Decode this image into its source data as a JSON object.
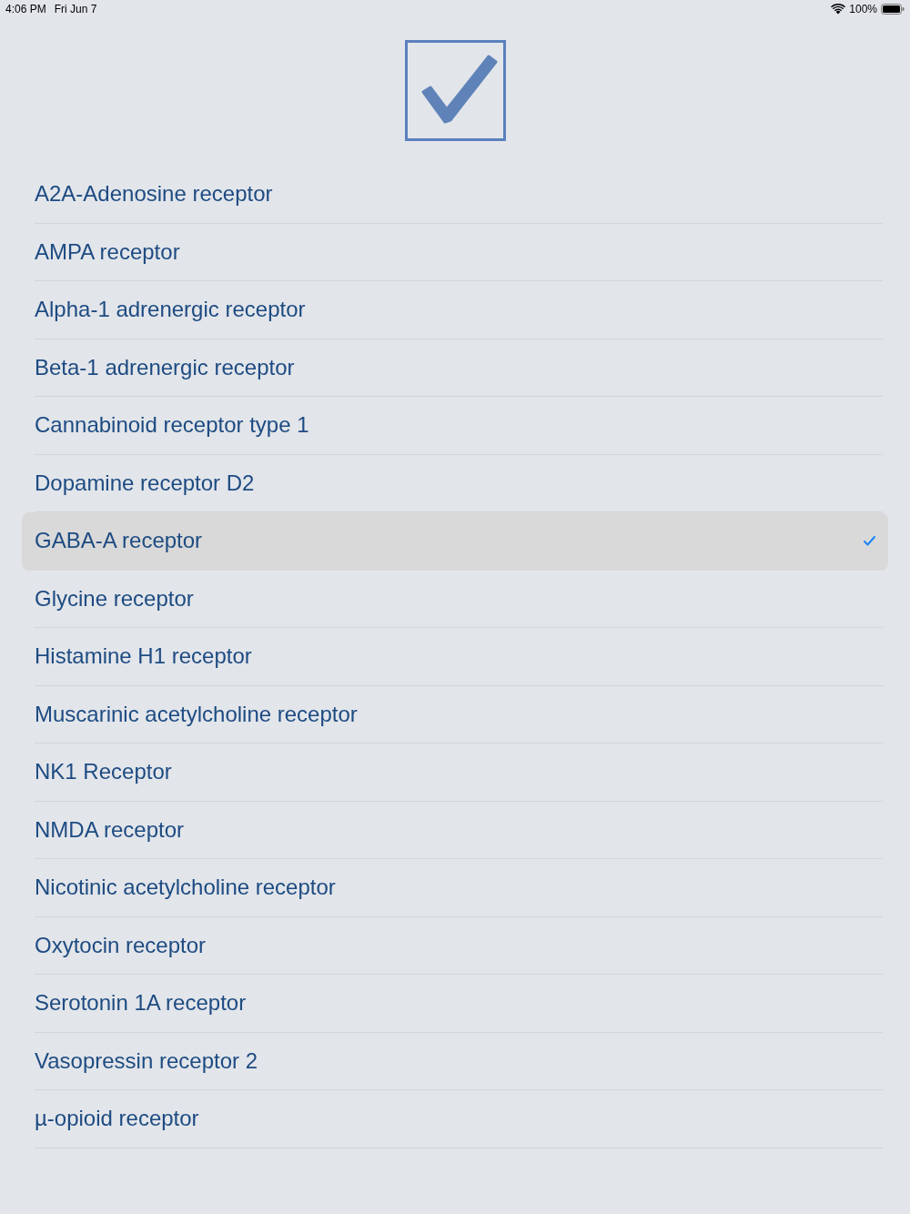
{
  "status_bar": {
    "time": "4:06 PM",
    "date": "Fri Jun 7",
    "battery": "100%"
  },
  "items": [
    {
      "label": "A2A-Adenosine receptor",
      "selected": false
    },
    {
      "label": "AMPA receptor",
      "selected": false
    },
    {
      "label": "Alpha-1 adrenergic receptor",
      "selected": false
    },
    {
      "label": "Beta-1 adrenergic receptor",
      "selected": false
    },
    {
      "label": "Cannabinoid receptor type 1",
      "selected": false
    },
    {
      "label": "Dopamine receptor D2",
      "selected": false
    },
    {
      "label": "GABA-A receptor",
      "selected": true
    },
    {
      "label": "Glycine receptor",
      "selected": false
    },
    {
      "label": "Histamine H1 receptor",
      "selected": false
    },
    {
      "label": "Muscarinic acetylcholine receptor",
      "selected": false
    },
    {
      "label": "NK1 Receptor",
      "selected": false
    },
    {
      "label": "NMDA receptor",
      "selected": false
    },
    {
      "label": "Nicotinic acetylcholine receptor",
      "selected": false
    },
    {
      "label": "Oxytocin receptor",
      "selected": false
    },
    {
      "label": "Serotonin 1A receptor",
      "selected": false
    },
    {
      "label": "Vasopressin receptor 2",
      "selected": false
    },
    {
      "label": "µ-opioid receptor",
      "selected": false
    }
  ]
}
